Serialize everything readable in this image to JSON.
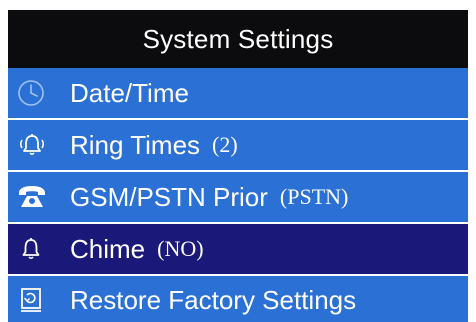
{
  "header": {
    "title": "System Settings"
  },
  "colors": {
    "header_background": "#0c0c0e",
    "item_background": "#2b70d4",
    "selected_background": "#1a1878",
    "text": "#ffffff"
  },
  "menu": {
    "items": [
      {
        "icon": "clock-icon",
        "label": "Date/Time",
        "value": ""
      },
      {
        "icon": "bell-ringing-icon",
        "label": "Ring Times",
        "value": "(2)"
      },
      {
        "icon": "telephone-icon",
        "label": "GSM/PSTN Prior",
        "value": "(PSTN)"
      },
      {
        "icon": "bell-icon",
        "label": "Chime",
        "value": "(NO)",
        "selected": true
      },
      {
        "icon": "restore-icon",
        "label": "Restore Factory Settings",
        "value": ""
      }
    ]
  }
}
